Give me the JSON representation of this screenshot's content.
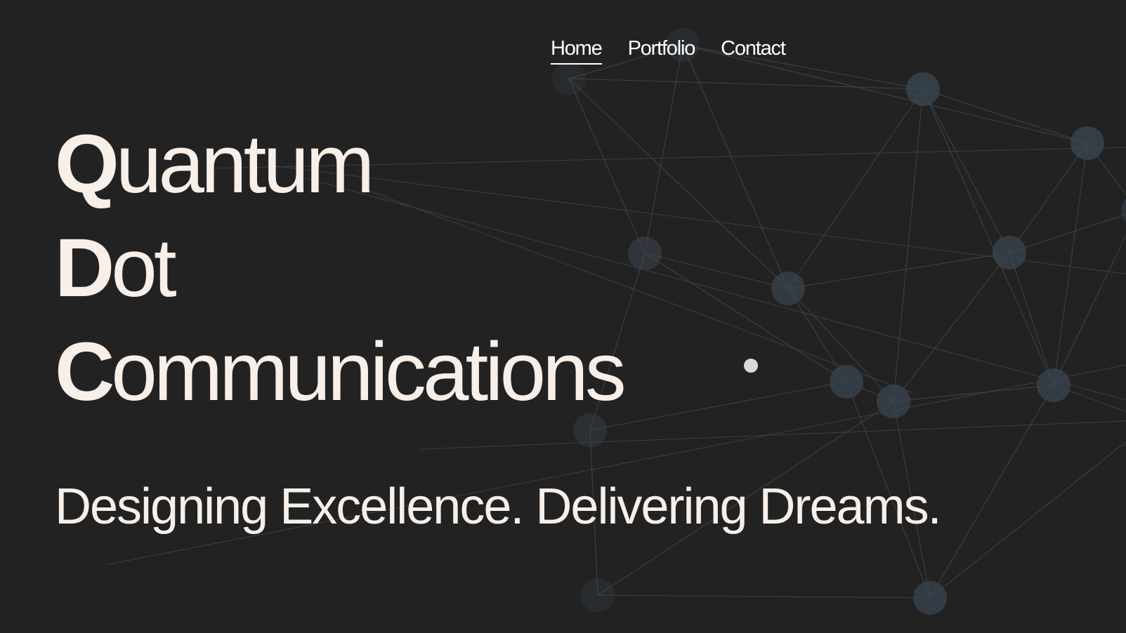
{
  "nav": {
    "items": [
      {
        "label": "Home",
        "active": true
      },
      {
        "label": "Portfolio",
        "active": false
      },
      {
        "label": "Contact",
        "active": false
      }
    ]
  },
  "hero": {
    "lines": [
      {
        "initial": "Q",
        "rest": "uantum"
      },
      {
        "initial": "D",
        "rest": "ot"
      },
      {
        "initial": "C",
        "rest": "ommunications"
      }
    ]
  },
  "tagline": "Designing Excellence. Delivering Dreams.",
  "colors": {
    "background": "#222222",
    "text": "#f7efe8",
    "node": "#3a4650",
    "line": "#3e4448"
  },
  "background_icon": "particle-network-icon"
}
